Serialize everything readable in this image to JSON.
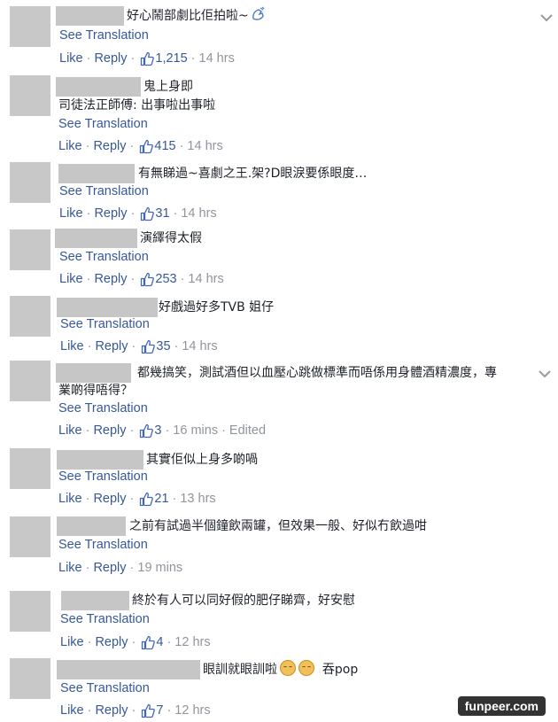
{
  "labels": {
    "see_translation": "See Translation",
    "like": "Like",
    "reply": "Reply"
  },
  "comments": [
    {
      "text": "好心鬧部劇比佢拍啦~",
      "likes": "1,215",
      "time": "14 hrs",
      "has_chevron": true
    },
    {
      "text": "鬼上身即",
      "text2": "司徒法正師傅: 出事啦出事啦",
      "likes": "415",
      "time": "14 hrs"
    },
    {
      "text": "有無睇過~喜劇之王.架?D眼淚要係眼度…",
      "likes": "31",
      "time": "14 hrs"
    },
    {
      "text": "演繹得太假",
      "likes": "253",
      "time": "14 hrs"
    },
    {
      "text": "好戲過好多TVB 姐仔",
      "likes": "35",
      "time": "14 hrs"
    },
    {
      "text": "都幾搞笑，測試酒但以血壓心跳做標準而唔係用身體酒精濃度，專",
      "text2": "業啲得唔得？",
      "likes": "3",
      "time": "16 mins",
      "edited": "Edited",
      "has_chevron": true
    },
    {
      "text": "其實佢似上身多啲喎",
      "likes": "21",
      "time": "13 hrs"
    },
    {
      "text": "之前有試過半個鐘飲兩罐，但效果一般、好似冇飲過咁",
      "time": "19 mins"
    },
    {
      "text": "終於有人可以同好假的肥仔睇齊，好安慰",
      "likes": "4",
      "time": "12 hrs"
    },
    {
      "text": "眼訓就眼訓啦",
      "text_suffix": "吞pop",
      "likes": "7",
      "time": "12 hrs"
    }
  ],
  "watermark": "funpeer.com",
  "colors": {
    "link": "#365899",
    "meta": "#90949c",
    "text": "#1d2129",
    "blur": "#c6c6c6"
  }
}
